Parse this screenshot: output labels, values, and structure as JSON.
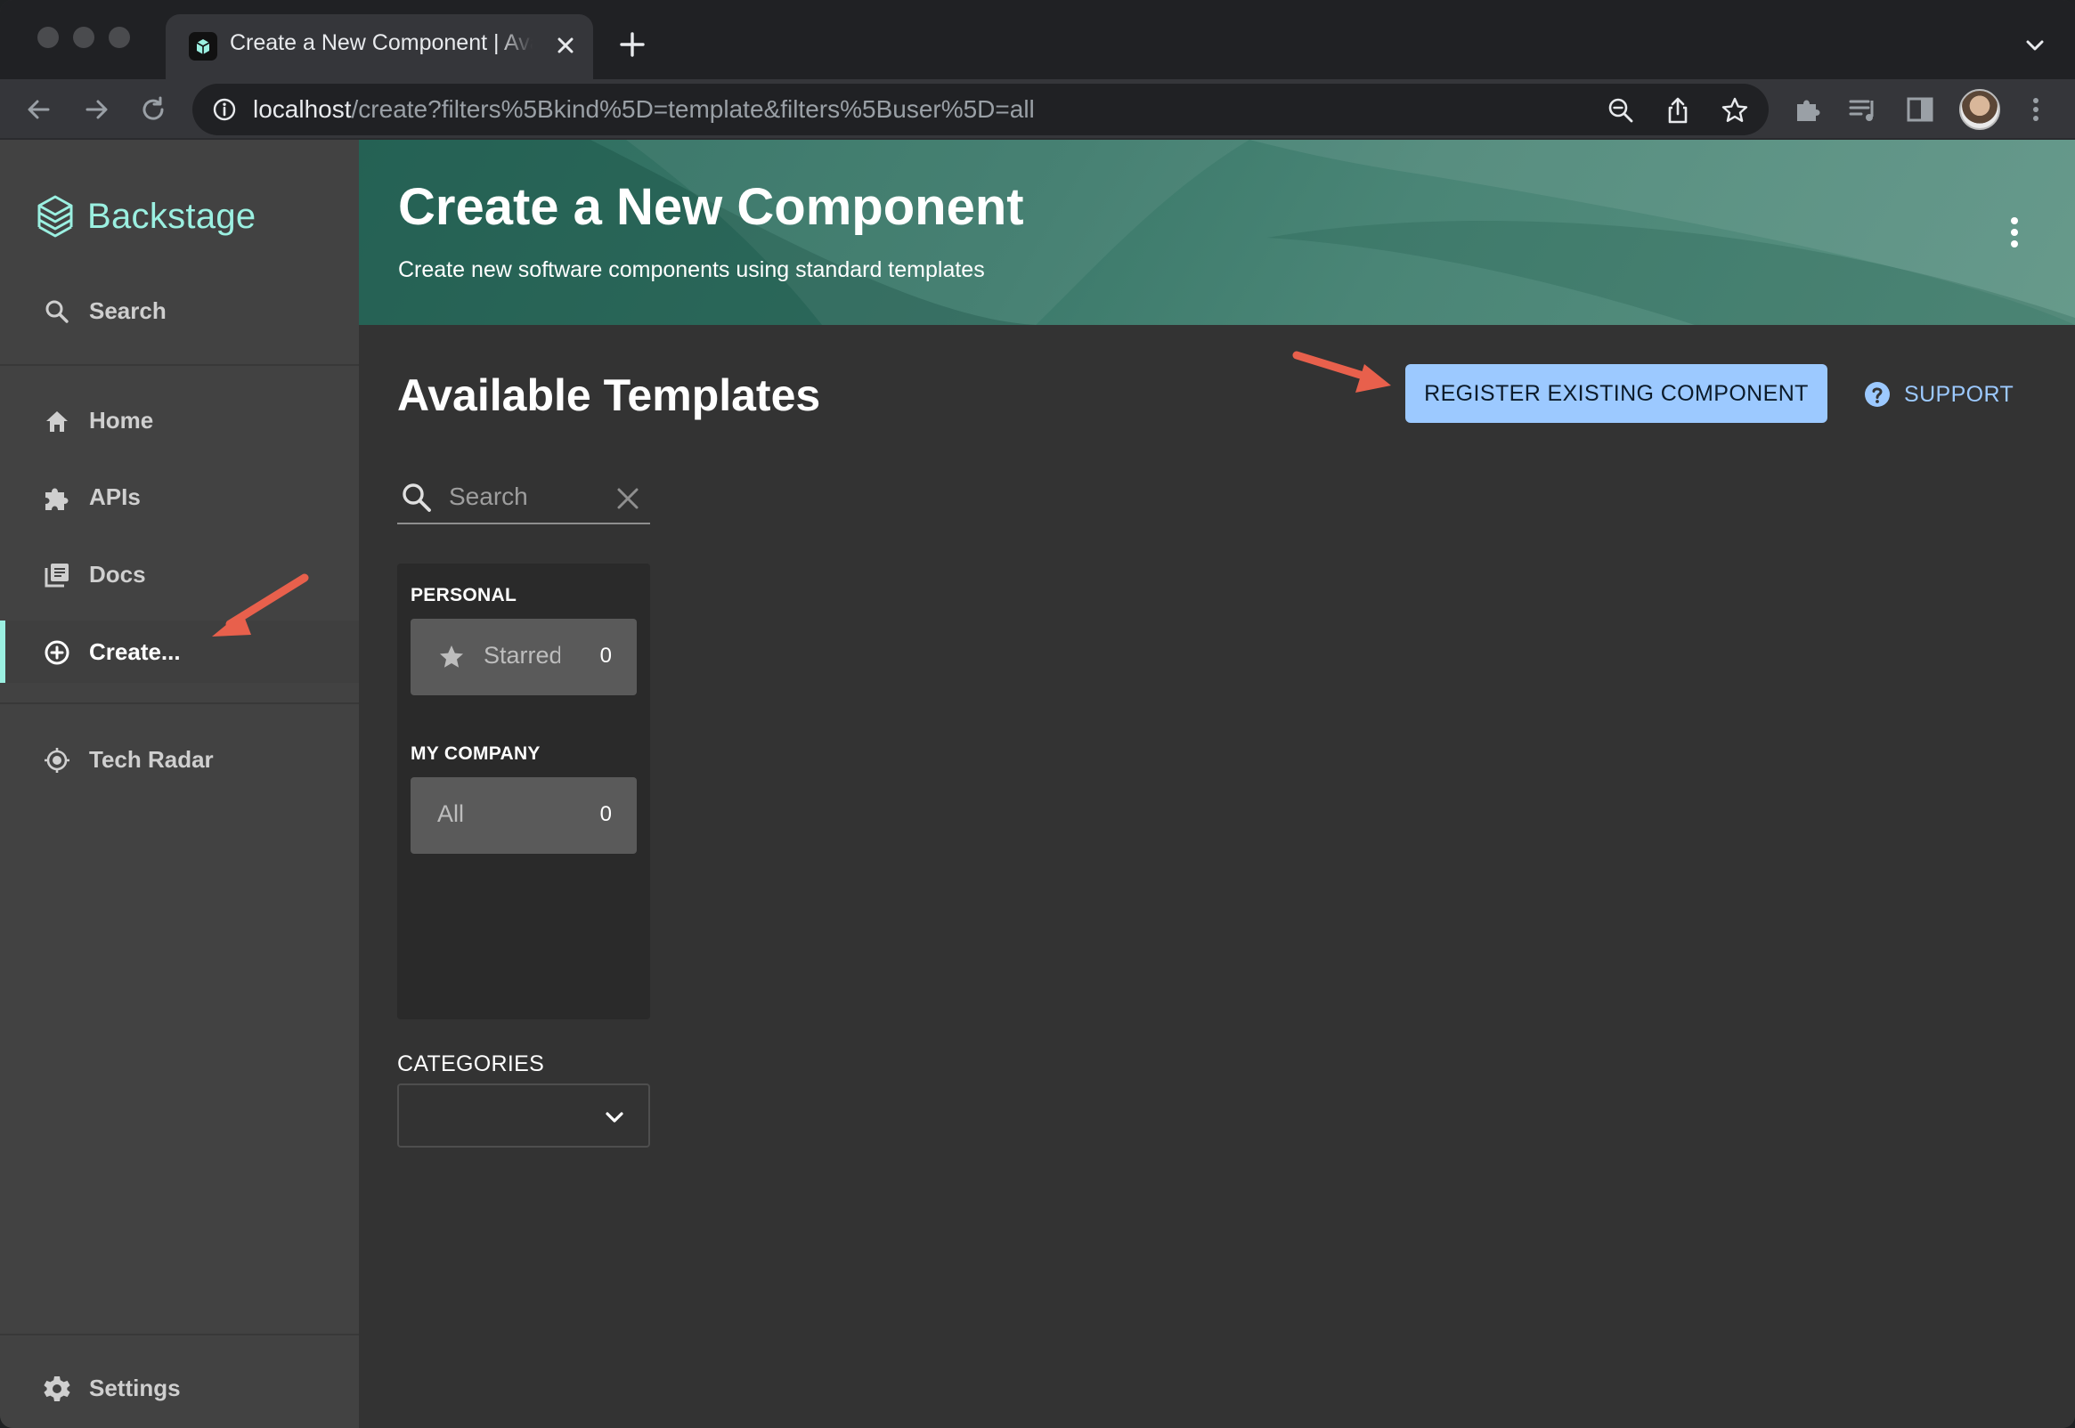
{
  "browser": {
    "tab_title": "Create a New Component | Available Templates",
    "url_host": "localhost",
    "url_path": "/create?filters%5Bkind%5D=template&filters%5Buser%5D=all"
  },
  "sidebar": {
    "logo_text": "Backstage",
    "search_label": "Search",
    "items": [
      {
        "label": "Home",
        "icon": "home-icon"
      },
      {
        "label": "APIs",
        "icon": "puzzle-icon"
      },
      {
        "label": "Docs",
        "icon": "library-icon"
      },
      {
        "label": "Create...",
        "icon": "plus-circle-icon",
        "active": true
      },
      {
        "label": "Tech Radar",
        "icon": "radar-icon"
      }
    ],
    "settings_label": "Settings"
  },
  "header": {
    "title": "Create a New Component",
    "subtitle": "Create new software components using standard templates"
  },
  "content": {
    "title": "Available Templates",
    "register_label": "REGISTER EXISTING COMPONENT",
    "support_label": "SUPPORT",
    "search_placeholder": "Search",
    "filters": {
      "personal_title": "PERSONAL",
      "starred_label": "Starred",
      "starred_count": "0",
      "company_title": "MY COMPANY",
      "all_label": "All",
      "all_count": "0"
    },
    "categories_label": "CATEGORIES"
  },
  "colors": {
    "accent": "#9bf0e1",
    "button_bg": "#9cc9ff",
    "annotation_arrow": "#e8604c"
  }
}
